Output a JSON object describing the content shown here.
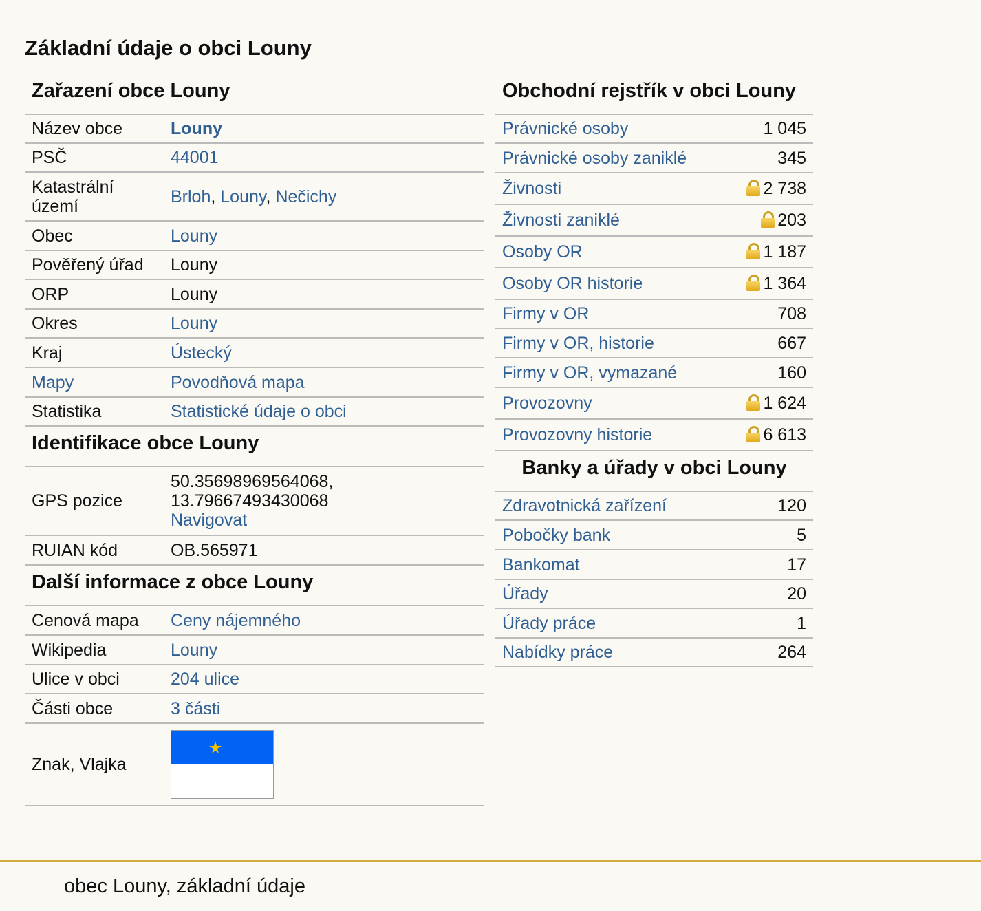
{
  "page_title": "Základní údaje o obci Louny",
  "zarazeni": {
    "title": "Zařazení obce Louny",
    "rows": [
      {
        "label": "Název obce",
        "value": "Louny"
      },
      {
        "label": "PSČ",
        "value": "44001"
      },
      {
        "label": "Katastrální území",
        "values": [
          "Brloh",
          "Louny",
          "Nečichy"
        ],
        "sep": ", "
      },
      {
        "label": "Obec",
        "value": "Louny"
      },
      {
        "label": "Pověřený úřad",
        "value": "Louny"
      },
      {
        "label": "ORP",
        "value": "Louny"
      },
      {
        "label": "Okres",
        "value": "Louny"
      },
      {
        "label": "Kraj",
        "value": "Ústecký"
      },
      {
        "label": "Mapy",
        "value": "Povodňová mapa"
      },
      {
        "label": "Statistika",
        "value": "Statistické údaje o obci"
      }
    ]
  },
  "identifikace": {
    "title": "Identifikace obce Louny",
    "gps_label": "GPS pozice",
    "gps_lat": "50.35698969564068,",
    "gps_lon": "13.79667493430068",
    "gps_link": "Navigovat",
    "ruian_label": "RUIAN kód",
    "ruian_value": "OB.565971"
  },
  "dalsi": {
    "title": "Další informace z obce Louny",
    "rows": [
      {
        "label": "Cenová mapa",
        "value": "Ceny nájemného"
      },
      {
        "label": "Wikipedia",
        "value": "Louny"
      },
      {
        "label": "Ulice v obci",
        "value": "204 ulice"
      },
      {
        "label": "Části obce",
        "value": "3 části"
      }
    ],
    "znak_label": "Znak, Vlajka",
    "flag_colors": {
      "top": "#0063f5",
      "bottom": "#ffffff",
      "emblem": "#f2c200"
    }
  },
  "obchodni": {
    "title": "Obchodní rejstřík v obci Louny",
    "rows": [
      {
        "label": "Právnické osoby",
        "value": "1 045",
        "locked": false
      },
      {
        "label": "Právnické osoby zaniklé",
        "value": "345",
        "locked": false
      },
      {
        "label": "Živnosti",
        "value": "2 738",
        "locked": true
      },
      {
        "label": "Živnosti zaniklé",
        "value": "203",
        "locked": true
      },
      {
        "label": "Osoby OR",
        "value": "1 187",
        "locked": true
      },
      {
        "label": "Osoby OR historie",
        "value": "1 364",
        "locked": true
      },
      {
        "label": "Firmy v OR",
        "value": "708",
        "locked": false
      },
      {
        "label": "Firmy v OR, historie",
        "value": "667",
        "locked": false
      },
      {
        "label": "Firmy v OR, vymazané",
        "value": "160",
        "locked": false
      },
      {
        "label": "Provozovny",
        "value": "1 624",
        "locked": true
      },
      {
        "label": "Provozovny historie",
        "value": "6 613",
        "locked": true
      }
    ]
  },
  "banky": {
    "title": "Banky a úřady v obci Louny",
    "rows": [
      {
        "label": "Zdravotnická zařízení",
        "value": "120"
      },
      {
        "label": "Pobočky bank",
        "value": "5"
      },
      {
        "label": "Bankomat",
        "value": "17"
      },
      {
        "label": "Úřady",
        "value": "20"
      },
      {
        "label": "Úřady práce",
        "value": "1"
      },
      {
        "label": "Nabídky práce",
        "value": "264"
      }
    ]
  },
  "footer": {
    "text": "obec Louny, základní údaje"
  },
  "colors": {
    "link": "#2f5f93",
    "footer_rule": "#d4ac3a",
    "background": "#faf9f4"
  }
}
